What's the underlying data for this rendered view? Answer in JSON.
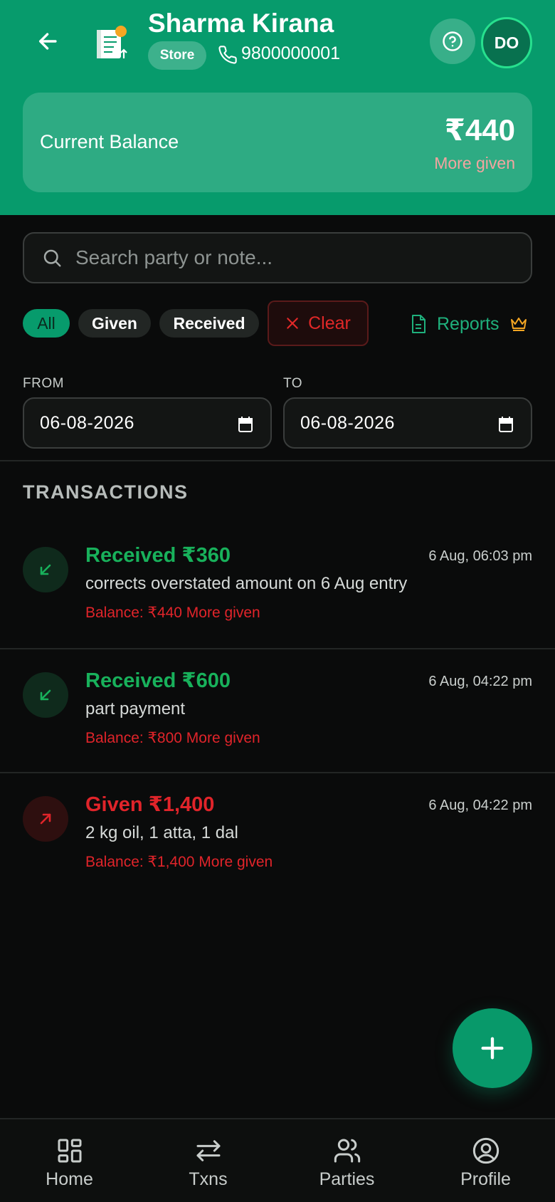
{
  "header": {
    "shop_name": "Sharma Kirana",
    "type_badge": "Store",
    "phone": "9800000001",
    "avatar_initials": "DO",
    "icons": {
      "back": "arrow-left-icon",
      "logo": "ledger-book-icon",
      "phone": "phone-icon",
      "help": "help-circle-icon"
    }
  },
  "balance": {
    "label": "Current Balance",
    "amount": "₹440",
    "status": "More given"
  },
  "search": {
    "placeholder": "Search party or note..."
  },
  "filters": {
    "chips": [
      "All",
      "Given",
      "Received"
    ],
    "selected": "All",
    "clear_label": "Clear",
    "reports_label": "Reports",
    "icons": {
      "clear": "close-icon",
      "reports": "document-icon",
      "premium": "crown-icon"
    }
  },
  "date_range": {
    "from_label": "FROM",
    "from_value": "06-08-2026",
    "to_label": "TO",
    "to_value": "06-08-2026"
  },
  "transactions": {
    "title": "TRANSACTIONS",
    "items": [
      {
        "kind": "received",
        "title": "Received ₹360",
        "time": "6 Aug, 06:03 pm",
        "note": "corrects overstated amount on 6 Aug entry",
        "balance": "Balance: ₹440 More given"
      },
      {
        "kind": "received",
        "title": "Received ₹600",
        "time": "6 Aug, 04:22 pm",
        "note": "part payment",
        "balance": "Balance: ₹800 More given"
      },
      {
        "kind": "given",
        "title": "Given ₹1,400",
        "time": "6 Aug, 04:22 pm",
        "note": "2 kg oil, 1 atta, 1 dal",
        "balance": "Balance: ₹1,400 More given"
      }
    ]
  },
  "colors": {
    "brand": "#079b6c",
    "received": "#18b15b",
    "given": "#e0242a",
    "premium": "#f5a623"
  },
  "bottom_nav": {
    "items": [
      {
        "label": "Home",
        "icon": "grid-icon"
      },
      {
        "label": "Txns",
        "icon": "swap-arrows-icon"
      },
      {
        "label": "Parties",
        "icon": "users-icon"
      },
      {
        "label": "Profile",
        "icon": "user-circle-icon"
      }
    ]
  }
}
